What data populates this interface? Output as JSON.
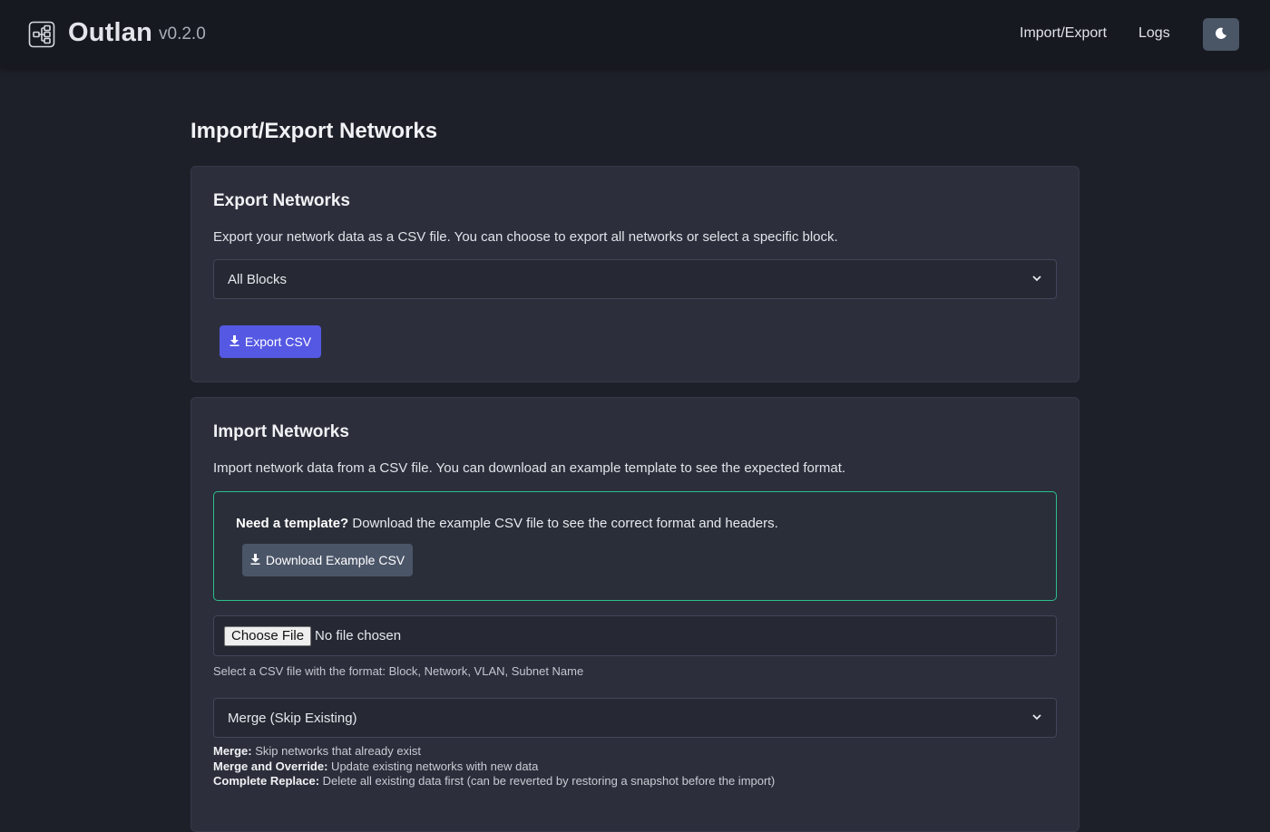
{
  "header": {
    "brand_name": "Outlan",
    "version": "v0.2.0",
    "logo_icon": "network-diagram-icon",
    "nav": [
      {
        "label": "Import/Export"
      },
      {
        "label": "Logs"
      }
    ],
    "theme_toggle_icon": "moon-icon"
  },
  "page": {
    "title": "Import/Export Networks"
  },
  "export_section": {
    "title": "Export Networks",
    "description": "Export your network data as a CSV file. You can choose to export all networks or select a specific block.",
    "block_select_value": "All Blocks",
    "export_button_label": "Export CSV",
    "export_button_icon": "download-icon"
  },
  "import_section": {
    "title": "Import Networks",
    "description": "Import network data from a CSV file. You can download an example template to see the expected format.",
    "template_prompt_bold": "Need a template?",
    "template_prompt_text": " Download the example CSV file to see the correct format and headers.",
    "download_example_label": "Download Example CSV",
    "choose_file_label": "Choose File",
    "file_status": "No file chosen",
    "file_help": "Select a CSV file with the format: Block, Network, VLAN, Subnet Name",
    "mode_select_value": "Merge (Skip Existing)",
    "mode_notes": [
      {
        "term": "Merge:",
        "text": " Skip networks that already exist"
      },
      {
        "term": "Merge and Override:",
        "text": " Update existing networks with new data"
      },
      {
        "term": "Complete Replace:",
        "text": " Delete all existing data first (can be reverted by restoring a snapshot before the import)"
      }
    ]
  },
  "colors": {
    "primary_button": "#5558e3",
    "secondary_button": "#4b5568",
    "template_border": "#2bbf8c",
    "background": "#1e2029"
  }
}
